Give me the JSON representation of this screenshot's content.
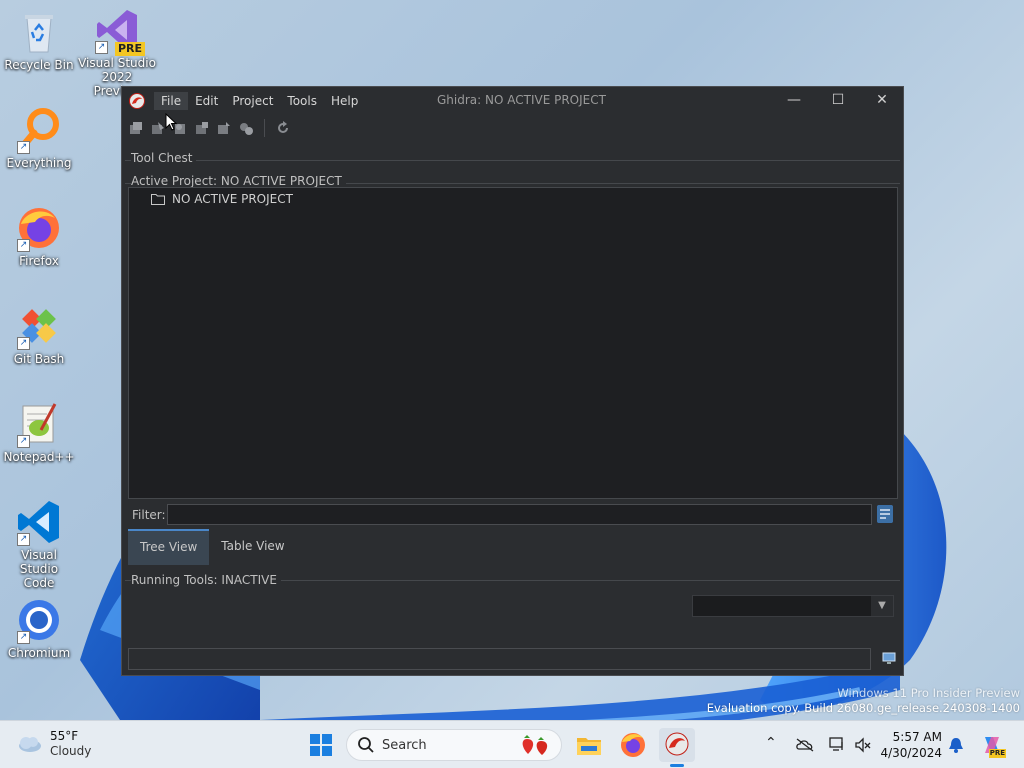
{
  "desktop": {
    "icons": [
      {
        "label": "Recycle Bin"
      },
      {
        "label": "Visual Studio 2022 Preview",
        "badge": "PRE"
      },
      {
        "label": "Everything"
      },
      {
        "label": "Firefox"
      },
      {
        "label": "Git Bash"
      },
      {
        "label": "Notepad++"
      },
      {
        "label": "Visual Studio Code"
      },
      {
        "label": "Chromium"
      }
    ],
    "watermark": {
      "line1": "Windows 11 Pro Insider Preview",
      "line2": "Evaluation copy. Build 26080.ge_release.240308-1400"
    }
  },
  "window": {
    "title": "Ghidra: NO ACTIVE PROJECT",
    "menu": [
      "File",
      "Edit",
      "Project",
      "Tools",
      "Help"
    ],
    "controls": {
      "minimize": "—",
      "maximize": "☐",
      "close": "✕"
    },
    "tool_chest_label": "Tool Chest",
    "active_project_label": "Active Project: NO ACTIVE PROJECT",
    "tree": {
      "root": "NO ACTIVE PROJECT"
    },
    "filter": {
      "label": "Filter:",
      "value": "",
      "placeholder": ""
    },
    "tabs": [
      "Tree View",
      "Table View"
    ],
    "selected_tab": "Tree View",
    "running_tools_label": "Running Tools: INACTIVE",
    "combo_value": ""
  },
  "taskbar": {
    "weather": {
      "temp": "55°F",
      "condition": "Cloudy"
    },
    "search_placeholder": "Search",
    "clock": {
      "time": "5:57 AM",
      "date": "4/30/2024"
    },
    "copilot_badge": "PRE"
  },
  "colors": {
    "window_bg": "#2b2d30",
    "tree_bg": "#1e1f22",
    "tab_selected": "#3a4652",
    "accent": "#4a87c9",
    "taskbar_bg": "#e6ecf2"
  }
}
